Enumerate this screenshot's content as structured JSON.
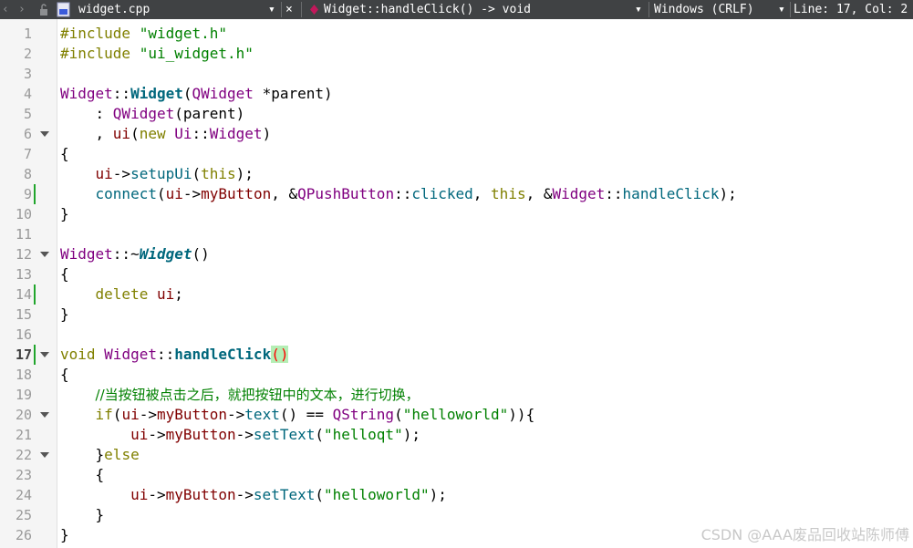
{
  "toolbar": {
    "back_arrow": "‹",
    "forward_arrow": "›",
    "file_name": "widget.cpp",
    "dropdown_arrow": "▾",
    "close_symbol": "×",
    "symbol_name": "Widget::handleClick() -> void",
    "encoding": "Windows (CRLF)",
    "position": "Line: 17, Col: 2"
  },
  "editor": {
    "current_line": 17,
    "line_numbers": [
      "1",
      "2",
      "3",
      "4",
      "5",
      "6",
      "7",
      "8",
      "9",
      "10",
      "11",
      "12",
      "13",
      "14",
      "15",
      "16",
      "17",
      "18",
      "19",
      "20",
      "21",
      "22",
      "23",
      "24",
      "25",
      "26"
    ],
    "fold_lines": [
      6,
      12,
      17,
      20,
      22
    ],
    "change_markers": [
      9,
      14,
      17
    ],
    "lines": [
      [
        {
          "t": "#include ",
          "c": "k"
        },
        {
          "t": "\"widget.h\"",
          "c": "s"
        }
      ],
      [
        {
          "t": "#include ",
          "c": "k"
        },
        {
          "t": "\"ui_widget.h\"",
          "c": "s"
        }
      ],
      [],
      [
        {
          "t": "Widget",
          "c": "t"
        },
        {
          "t": "::"
        },
        {
          "t": "Widget",
          "c": "fb"
        },
        {
          "t": "("
        },
        {
          "t": "QWidget",
          "c": "t"
        },
        {
          "t": " *"
        },
        {
          "t": "parent"
        },
        {
          "t": ")"
        }
      ],
      [
        {
          "t": "    : "
        },
        {
          "t": "QWidget",
          "c": "t"
        },
        {
          "t": "(parent)"
        }
      ],
      [
        {
          "t": "    , "
        },
        {
          "t": "ui",
          "c": "m"
        },
        {
          "t": "("
        },
        {
          "t": "new ",
          "c": "k"
        },
        {
          "t": "Ui",
          "c": "t"
        },
        {
          "t": "::"
        },
        {
          "t": "Widget",
          "c": "t"
        },
        {
          "t": ")"
        }
      ],
      [
        {
          "t": "{"
        }
      ],
      [
        {
          "t": "    "
        },
        {
          "t": "ui",
          "c": "m"
        },
        {
          "t": "->"
        },
        {
          "t": "setupUi",
          "c": "f"
        },
        {
          "t": "("
        },
        {
          "t": "this",
          "c": "k"
        },
        {
          "t": ");"
        }
      ],
      [
        {
          "t": "    "
        },
        {
          "t": "connect",
          "c": "f"
        },
        {
          "t": "("
        },
        {
          "t": "ui",
          "c": "m"
        },
        {
          "t": "->"
        },
        {
          "t": "myButton",
          "c": "m"
        },
        {
          "t": ", &"
        },
        {
          "t": "QPushButton",
          "c": "t"
        },
        {
          "t": "::"
        },
        {
          "t": "clicked",
          "c": "f"
        },
        {
          "t": ", "
        },
        {
          "t": "this",
          "c": "k"
        },
        {
          "t": ", &"
        },
        {
          "t": "Widget",
          "c": "t"
        },
        {
          "t": "::"
        },
        {
          "t": "handleClick",
          "c": "f"
        },
        {
          "t": ");"
        }
      ],
      [
        {
          "t": "}"
        }
      ],
      [],
      [
        {
          "t": "Widget",
          "c": "t"
        },
        {
          "t": "::~"
        },
        {
          "t": "Widget",
          "c": "fbi"
        },
        {
          "t": "()"
        }
      ],
      [
        {
          "t": "{"
        }
      ],
      [
        {
          "t": "    "
        },
        {
          "t": "delete ",
          "c": "k"
        },
        {
          "t": "ui",
          "c": "m"
        },
        {
          "t": ";"
        }
      ],
      [
        {
          "t": "}"
        }
      ],
      [],
      [
        {
          "t": "void ",
          "c": "k"
        },
        {
          "t": "Widget",
          "c": "t"
        },
        {
          "t": "::"
        },
        {
          "t": "handleClick",
          "c": "fb"
        },
        {
          "t": "()",
          "c": "hl"
        }
      ],
      [
        {
          "t": "{"
        }
      ],
      [
        {
          "t": "    "
        },
        {
          "t": "//当按钮被点击之后，就把按钮中的文本，进行切换，",
          "c": "c"
        }
      ],
      [
        {
          "t": "    "
        },
        {
          "t": "if",
          "c": "k"
        },
        {
          "t": "("
        },
        {
          "t": "ui",
          "c": "m"
        },
        {
          "t": "->"
        },
        {
          "t": "myButton",
          "c": "m"
        },
        {
          "t": "->"
        },
        {
          "t": "text",
          "c": "f"
        },
        {
          "t": "() == "
        },
        {
          "t": "QString",
          "c": "t"
        },
        {
          "t": "("
        },
        {
          "t": "\"helloworld\"",
          "c": "s"
        },
        {
          "t": ")){"
        }
      ],
      [
        {
          "t": "        "
        },
        {
          "t": "ui",
          "c": "m"
        },
        {
          "t": "->"
        },
        {
          "t": "myButton",
          "c": "m"
        },
        {
          "t": "->"
        },
        {
          "t": "setText",
          "c": "f"
        },
        {
          "t": "("
        },
        {
          "t": "\"helloqt\"",
          "c": "s"
        },
        {
          "t": ");"
        }
      ],
      [
        {
          "t": "    }"
        },
        {
          "t": "else",
          "c": "k"
        }
      ],
      [
        {
          "t": "    {"
        }
      ],
      [
        {
          "t": "        "
        },
        {
          "t": "ui",
          "c": "m"
        },
        {
          "t": "->"
        },
        {
          "t": "myButton",
          "c": "m"
        },
        {
          "t": "->"
        },
        {
          "t": "setText",
          "c": "f"
        },
        {
          "t": "("
        },
        {
          "t": "\"helloworld\"",
          "c": "s"
        },
        {
          "t": ");"
        }
      ],
      [
        {
          "t": "    }"
        }
      ],
      [
        {
          "t": "}"
        }
      ]
    ]
  },
  "watermark": "CSDN @AAA废品回收站陈师傅"
}
